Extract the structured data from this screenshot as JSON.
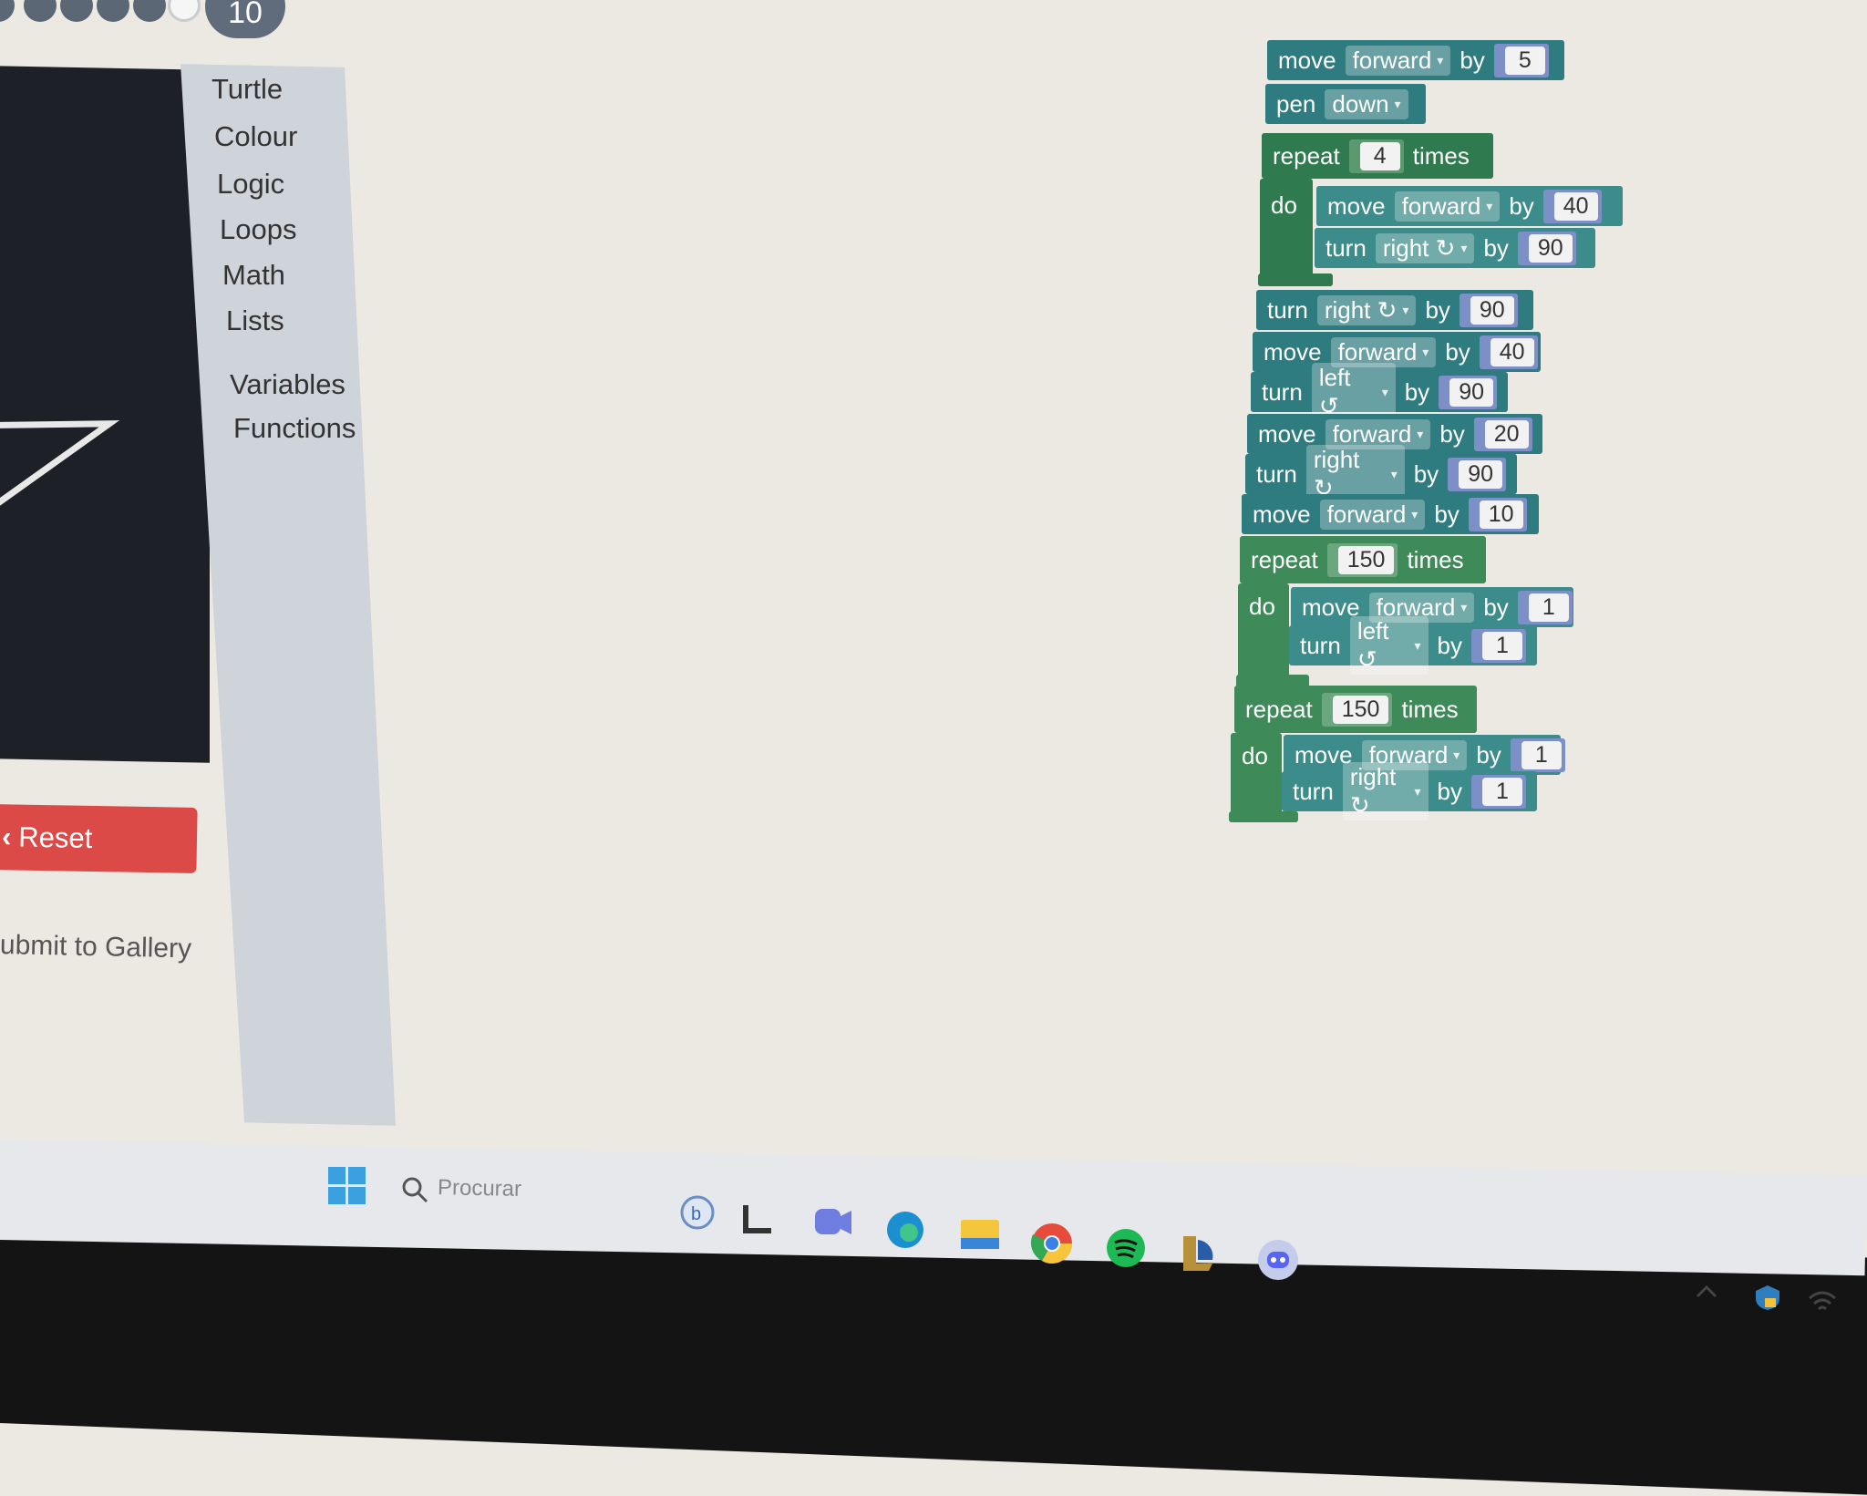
{
  "header": {
    "level_number": "10",
    "level_dots": [
      "done",
      "done",
      "done",
      "done",
      "done",
      "current"
    ]
  },
  "toolbox": {
    "categories": [
      "Turtle",
      "Colour",
      "Logic",
      "Loops",
      "Math",
      "Lists",
      "Variables",
      "Functions"
    ]
  },
  "controls": {
    "reset_label": "Reset",
    "submit_label": "ubmit to Gallery"
  },
  "blocks": {
    "b1": {
      "kw": "move",
      "dir": "forward",
      "by": "by",
      "val": "5"
    },
    "b2": {
      "kw": "pen",
      "dir": "down"
    },
    "r1": {
      "kw": "repeat",
      "count": "4",
      "times": "times",
      "do": "do"
    },
    "r1a": {
      "kw": "move",
      "dir": "forward",
      "by": "by",
      "val": "40"
    },
    "r1b": {
      "kw": "turn",
      "dir": "right ↻",
      "by": "by",
      "val": "90"
    },
    "b3": {
      "kw": "turn",
      "dir": "right ↻",
      "by": "by",
      "val": "90"
    },
    "b4": {
      "kw": "move",
      "dir": "forward",
      "by": "by",
      "val": "40"
    },
    "b5": {
      "kw": "turn",
      "dir": "left ↺",
      "by": "by",
      "val": "90"
    },
    "b6": {
      "kw": "move",
      "dir": "forward",
      "by": "by",
      "val": "20"
    },
    "b7": {
      "kw": "turn",
      "dir": "right ↻",
      "by": "by",
      "val": "90"
    },
    "b8": {
      "kw": "move",
      "dir": "forward",
      "by": "by",
      "val": "10"
    },
    "r2": {
      "kw": "repeat",
      "count": "150",
      "times": "times",
      "do": "do"
    },
    "r2a": {
      "kw": "move",
      "dir": "forward",
      "by": "by",
      "val": "1"
    },
    "r2b": {
      "kw": "turn",
      "dir": "left ↺",
      "by": "by",
      "val": "1"
    },
    "r3": {
      "kw": "repeat",
      "count": "150",
      "times": "times",
      "do": "do"
    },
    "r3a": {
      "kw": "move",
      "dir": "forward",
      "by": "by",
      "val": "1"
    },
    "r3b": {
      "kw": "turn",
      "dir": "right ↻",
      "by": "by",
      "val": "1"
    }
  },
  "taskbar": {
    "search_placeholder": "Procurar",
    "icons": [
      "windows-start-icon",
      "search-icon",
      "bing-icon",
      "file-l-icon",
      "meet-icon",
      "edge-icon",
      "file-explorer-icon",
      "chrome-icon",
      "spotify-icon",
      "league-icon",
      "discord-icon"
    ]
  },
  "colors": {
    "turtle_block": "#2e7c80",
    "loop_block": "#2f7a4e",
    "number_socket": "#7c8fc7",
    "reset_button": "#dc4a47"
  }
}
